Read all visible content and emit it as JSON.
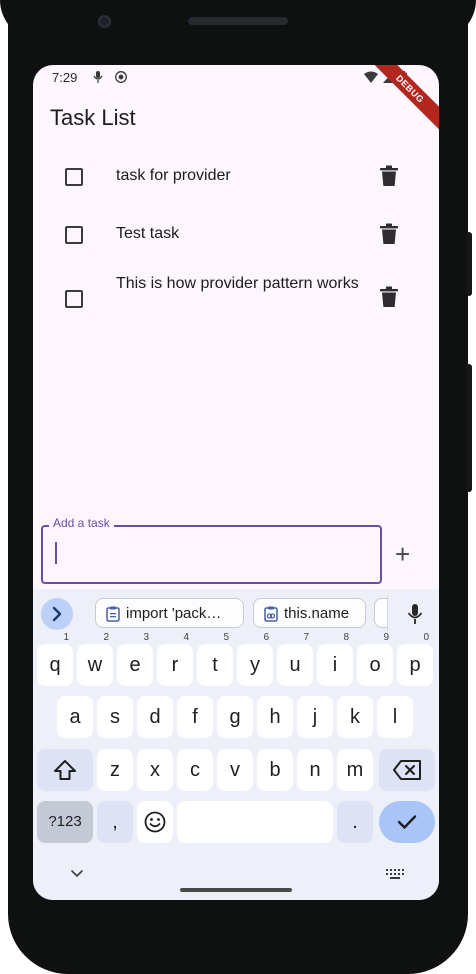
{
  "status_bar": {
    "time": "7:29",
    "debug_label": "DEBUG"
  },
  "app": {
    "title": "Task List",
    "tasks": [
      {
        "label": "task for provider"
      },
      {
        "label": "Test task"
      },
      {
        "label": "This is how provider pattern works"
      }
    ],
    "input": {
      "label": "Add a task",
      "value": ""
    },
    "add_icon": "+"
  },
  "keyboard": {
    "suggestions": [
      "import 'pack…",
      "this.name"
    ],
    "row1": [
      "q",
      "w",
      "e",
      "r",
      "t",
      "y",
      "u",
      "i",
      "o",
      "p"
    ],
    "row1_hints": [
      "1",
      "2",
      "3",
      "4",
      "5",
      "6",
      "7",
      "8",
      "9",
      "0"
    ],
    "row2": [
      "a",
      "s",
      "d",
      "f",
      "g",
      "h",
      "j",
      "k",
      "l"
    ],
    "row3": [
      "z",
      "x",
      "c",
      "v",
      "b",
      "n",
      "m"
    ],
    "symbols_label": "?123",
    "comma_label": ",",
    "period_label": "."
  },
  "colors": {
    "accent": "#6650a4",
    "screen_bg": "#fdf6fe",
    "keyboard_bg": "#eef0f9",
    "action_key": "#a9c4f6",
    "debug_ribbon": "#b3261e"
  }
}
